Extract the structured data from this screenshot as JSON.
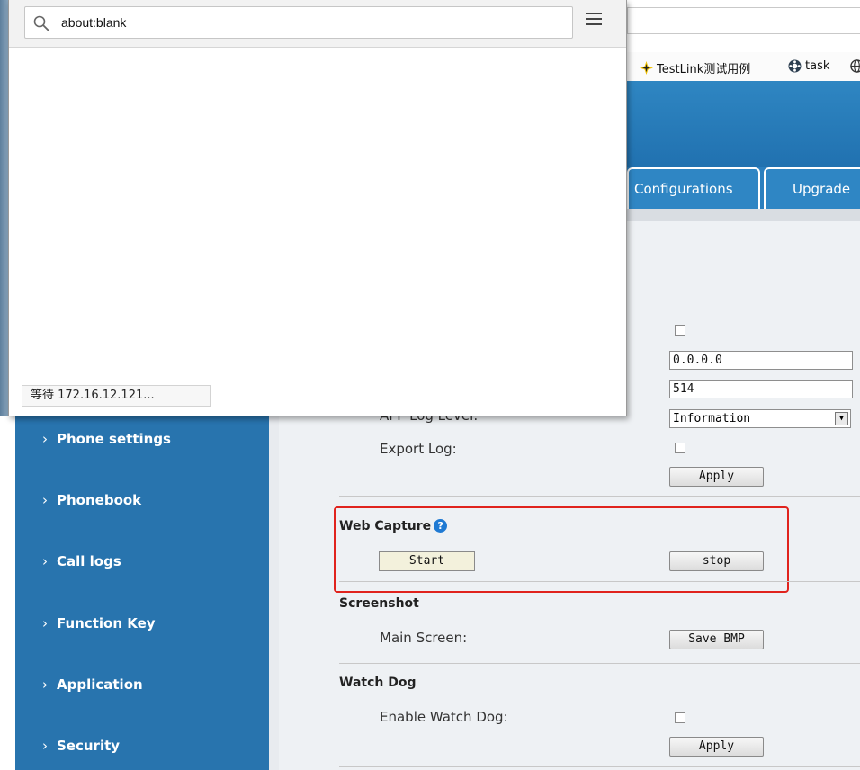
{
  "popup": {
    "url": "about:blank",
    "status_text": "等待 172.16.12.121..."
  },
  "bookmarks": [
    {
      "icon": "testlink-icon",
      "label": "TestLink测试用例"
    },
    {
      "icon": "task-icon",
      "label": "task"
    }
  ],
  "tabs": [
    {
      "label": "Configurations"
    },
    {
      "label": "Upgrade"
    }
  ],
  "sidebar": {
    "items": [
      {
        "label": "Phone settings"
      },
      {
        "label": "Phonebook"
      },
      {
        "label": "Call logs"
      },
      {
        "label": "Function Key"
      },
      {
        "label": "Application"
      },
      {
        "label": "Security"
      }
    ]
  },
  "log": {
    "server_ip": "0.0.0.0",
    "server_port": "514",
    "app_log_level_label": "APP Log Level:",
    "app_log_level_value": "Information",
    "export_log_label": "Export Log:",
    "apply_label": "Apply"
  },
  "web_capture": {
    "title": "Web Capture",
    "start_label": "Start",
    "stop_label": "stop"
  },
  "screenshot": {
    "title": "Screenshot",
    "main_screen_label": "Main Screen:",
    "save_label": "Save BMP"
  },
  "watch_dog": {
    "title": "Watch Dog",
    "enable_label": "Enable Watch Dog:",
    "apply_label": "Apply"
  },
  "colors": {
    "sidebar": "#2874ae",
    "highlight": "#e0231d",
    "help_icon": "#1f7ad3"
  }
}
